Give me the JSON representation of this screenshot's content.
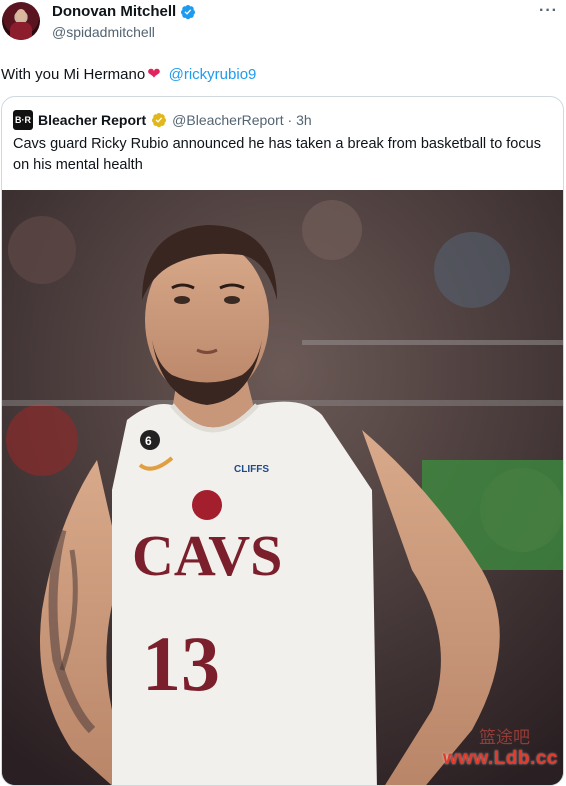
{
  "author": {
    "display_name": "Donovan Mitchell",
    "handle": "@spidadmitchell",
    "verified_icon": "verified-badge-icon",
    "more_label": "···"
  },
  "tweet": {
    "text": "With you Mi Hermano",
    "heart": "❤",
    "mention": "@rickyrubio9"
  },
  "quote": {
    "logo_text": "B·R",
    "name": "Bleacher Report",
    "handle_time": "@BleacherReport · 3h",
    "text": "Cavs guard Ricky Rubio announced he has taken a break from basketball to focus on his mental health",
    "photo": {
      "jersey_team": "CAVS",
      "jersey_number": "13",
      "patch_number": "6",
      "sponsor": "CLIFFS"
    }
  },
  "watermark": {
    "site": "www.Ldb.cc",
    "cn": "篮途吧"
  },
  "colors": {
    "link": "#1d9bf0",
    "verified_blue": "#1d9bf0",
    "verified_gold": "#e2b719",
    "jersey_red": "#7a1f2b"
  }
}
